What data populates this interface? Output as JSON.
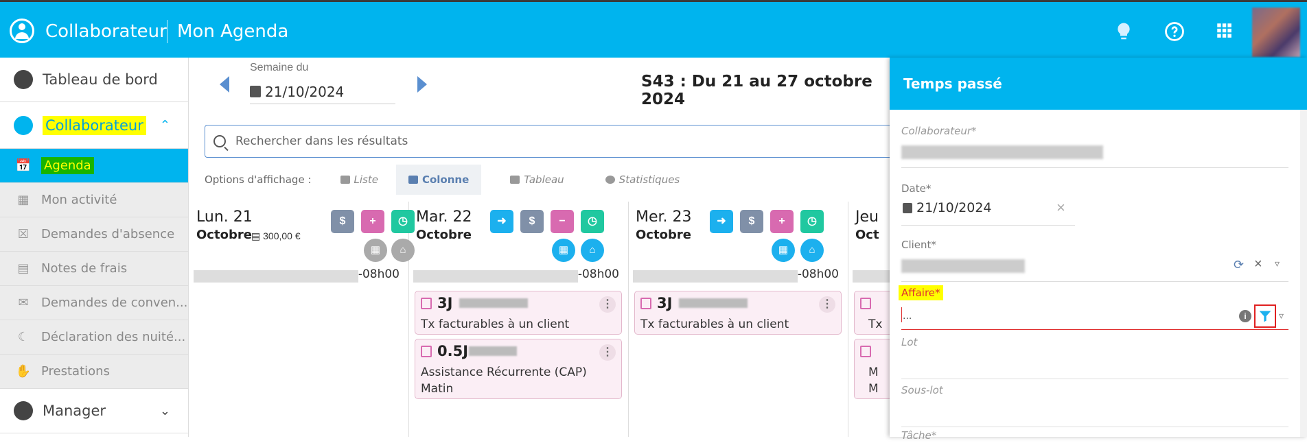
{
  "header": {
    "app_title": "Collaborateur",
    "page_title": "Mon Agenda",
    "icons": [
      "user-circle-icon",
      "lightbulb-icon",
      "help-icon",
      "apps-grid-icon"
    ]
  },
  "sidebar": {
    "items": [
      {
        "label": "Tableau de bord",
        "icon": "dashboard-icon"
      },
      {
        "label": "Collaborateur",
        "icon": "user-icon"
      },
      {
        "label": "Agenda",
        "icon": "calendar-icon"
      },
      {
        "label": "Mon activité",
        "icon": "calendar-clock-icon"
      },
      {
        "label": "Demandes d'absence",
        "icon": "calendar-x-icon"
      },
      {
        "label": "Notes de frais",
        "icon": "receipt-icon"
      },
      {
        "label": "Demandes de conven...",
        "icon": "chat-icon"
      },
      {
        "label": "Déclaration des nuité...",
        "icon": "moon-icon"
      },
      {
        "label": "Prestations",
        "icon": "hand-icon"
      },
      {
        "label": "Manager",
        "icon": "group-icon"
      }
    ]
  },
  "week": {
    "label": "Semaine du",
    "date": "21/10/2024",
    "period": "S43 : Du 21 au 27 octobre 2024"
  },
  "search": {
    "placeholder": "Rechercher dans les résultats"
  },
  "display_options": {
    "label": "Options d'affichage :",
    "options": [
      "Liste",
      "Colonne",
      "Tableau",
      "Statistiques"
    ],
    "selected": "Colonne"
  },
  "days": [
    {
      "day": "Lun. 21",
      "month": "Octobre",
      "amount": "300,00 €",
      "hours": "-08h00"
    },
    {
      "day": "Mar. 22",
      "month": "Octobre",
      "hours": "-08h00",
      "cards": [
        {
          "duration": "3J",
          "text": "Tx facturables à un client"
        },
        {
          "duration": "0.5J",
          "text": "Assistance Récurrente (CAP)",
          "text2": "Matin"
        }
      ]
    },
    {
      "day": "Mer. 23",
      "month": "Octobre",
      "hours": "-08h00",
      "cards": [
        {
          "duration": "3J",
          "text": "Tx facturables à un client"
        }
      ]
    },
    {
      "day": "Jeu",
      "month": "Oct",
      "card_stubs": [
        "Tx",
        "M",
        "M"
      ]
    }
  ],
  "panel": {
    "title": "Temps passé",
    "fields": {
      "collaborateur": "Collaborateur*",
      "date_label": "Date*",
      "date_value": "21/10/2024",
      "client": "Client*",
      "affaire": "Affaire*",
      "affaire_value": "...",
      "lot": "Lot",
      "sous_lot": "Sous-lot",
      "tache": "Tâche*"
    }
  },
  "colors": {
    "accent": "#00b4ee",
    "highlight_yellow": "#ffff00",
    "highlight_green": "#18b400",
    "pink": "#d86ab0",
    "teal": "#20c8a0"
  }
}
